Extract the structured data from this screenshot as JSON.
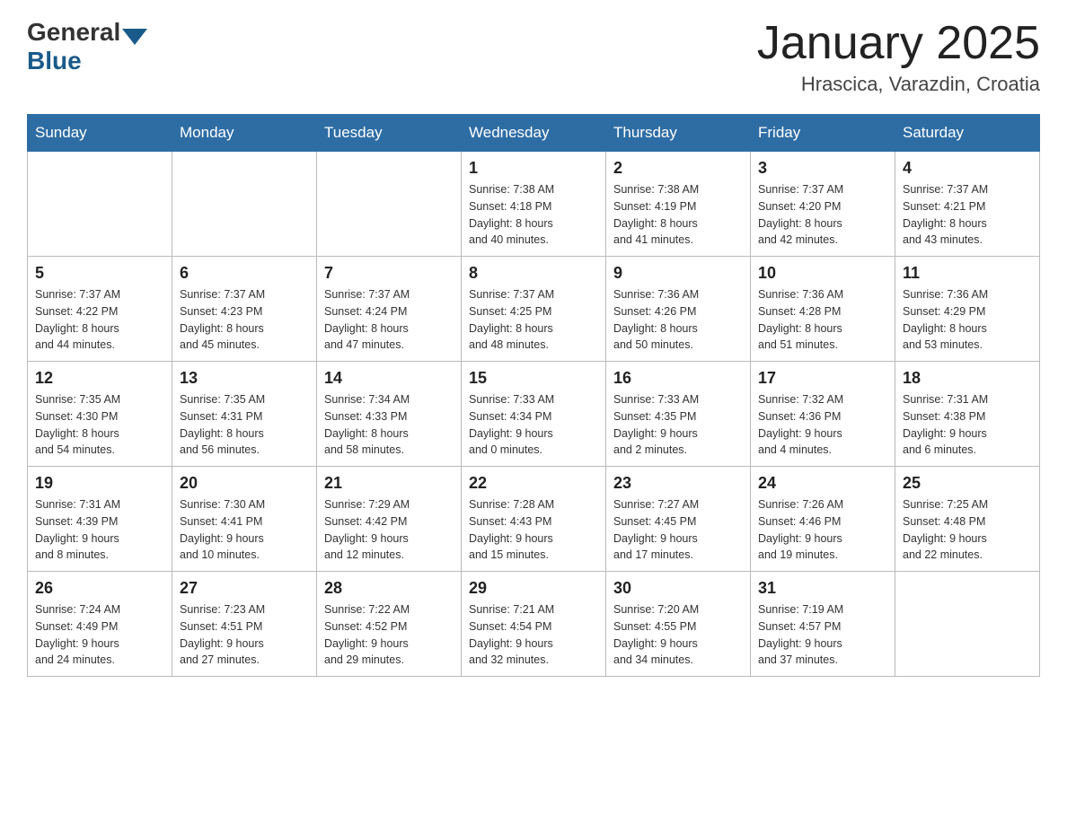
{
  "header": {
    "logo_general": "General",
    "logo_blue": "Blue",
    "title": "January 2025",
    "location": "Hrascica, Varazdin, Croatia"
  },
  "days_of_week": [
    "Sunday",
    "Monday",
    "Tuesday",
    "Wednesday",
    "Thursday",
    "Friday",
    "Saturday"
  ],
  "weeks": [
    [
      {
        "day": "",
        "info": ""
      },
      {
        "day": "",
        "info": ""
      },
      {
        "day": "",
        "info": ""
      },
      {
        "day": "1",
        "info": "Sunrise: 7:38 AM\nSunset: 4:18 PM\nDaylight: 8 hours\nand 40 minutes."
      },
      {
        "day": "2",
        "info": "Sunrise: 7:38 AM\nSunset: 4:19 PM\nDaylight: 8 hours\nand 41 minutes."
      },
      {
        "day": "3",
        "info": "Sunrise: 7:37 AM\nSunset: 4:20 PM\nDaylight: 8 hours\nand 42 minutes."
      },
      {
        "day": "4",
        "info": "Sunrise: 7:37 AM\nSunset: 4:21 PM\nDaylight: 8 hours\nand 43 minutes."
      }
    ],
    [
      {
        "day": "5",
        "info": "Sunrise: 7:37 AM\nSunset: 4:22 PM\nDaylight: 8 hours\nand 44 minutes."
      },
      {
        "day": "6",
        "info": "Sunrise: 7:37 AM\nSunset: 4:23 PM\nDaylight: 8 hours\nand 45 minutes."
      },
      {
        "day": "7",
        "info": "Sunrise: 7:37 AM\nSunset: 4:24 PM\nDaylight: 8 hours\nand 47 minutes."
      },
      {
        "day": "8",
        "info": "Sunrise: 7:37 AM\nSunset: 4:25 PM\nDaylight: 8 hours\nand 48 minutes."
      },
      {
        "day": "9",
        "info": "Sunrise: 7:36 AM\nSunset: 4:26 PM\nDaylight: 8 hours\nand 50 minutes."
      },
      {
        "day": "10",
        "info": "Sunrise: 7:36 AM\nSunset: 4:28 PM\nDaylight: 8 hours\nand 51 minutes."
      },
      {
        "day": "11",
        "info": "Sunrise: 7:36 AM\nSunset: 4:29 PM\nDaylight: 8 hours\nand 53 minutes."
      }
    ],
    [
      {
        "day": "12",
        "info": "Sunrise: 7:35 AM\nSunset: 4:30 PM\nDaylight: 8 hours\nand 54 minutes."
      },
      {
        "day": "13",
        "info": "Sunrise: 7:35 AM\nSunset: 4:31 PM\nDaylight: 8 hours\nand 56 minutes."
      },
      {
        "day": "14",
        "info": "Sunrise: 7:34 AM\nSunset: 4:33 PM\nDaylight: 8 hours\nand 58 minutes."
      },
      {
        "day": "15",
        "info": "Sunrise: 7:33 AM\nSunset: 4:34 PM\nDaylight: 9 hours\nand 0 minutes."
      },
      {
        "day": "16",
        "info": "Sunrise: 7:33 AM\nSunset: 4:35 PM\nDaylight: 9 hours\nand 2 minutes."
      },
      {
        "day": "17",
        "info": "Sunrise: 7:32 AM\nSunset: 4:36 PM\nDaylight: 9 hours\nand 4 minutes."
      },
      {
        "day": "18",
        "info": "Sunrise: 7:31 AM\nSunset: 4:38 PM\nDaylight: 9 hours\nand 6 minutes."
      }
    ],
    [
      {
        "day": "19",
        "info": "Sunrise: 7:31 AM\nSunset: 4:39 PM\nDaylight: 9 hours\nand 8 minutes."
      },
      {
        "day": "20",
        "info": "Sunrise: 7:30 AM\nSunset: 4:41 PM\nDaylight: 9 hours\nand 10 minutes."
      },
      {
        "day": "21",
        "info": "Sunrise: 7:29 AM\nSunset: 4:42 PM\nDaylight: 9 hours\nand 12 minutes."
      },
      {
        "day": "22",
        "info": "Sunrise: 7:28 AM\nSunset: 4:43 PM\nDaylight: 9 hours\nand 15 minutes."
      },
      {
        "day": "23",
        "info": "Sunrise: 7:27 AM\nSunset: 4:45 PM\nDaylight: 9 hours\nand 17 minutes."
      },
      {
        "day": "24",
        "info": "Sunrise: 7:26 AM\nSunset: 4:46 PM\nDaylight: 9 hours\nand 19 minutes."
      },
      {
        "day": "25",
        "info": "Sunrise: 7:25 AM\nSunset: 4:48 PM\nDaylight: 9 hours\nand 22 minutes."
      }
    ],
    [
      {
        "day": "26",
        "info": "Sunrise: 7:24 AM\nSunset: 4:49 PM\nDaylight: 9 hours\nand 24 minutes."
      },
      {
        "day": "27",
        "info": "Sunrise: 7:23 AM\nSunset: 4:51 PM\nDaylight: 9 hours\nand 27 minutes."
      },
      {
        "day": "28",
        "info": "Sunrise: 7:22 AM\nSunset: 4:52 PM\nDaylight: 9 hours\nand 29 minutes."
      },
      {
        "day": "29",
        "info": "Sunrise: 7:21 AM\nSunset: 4:54 PM\nDaylight: 9 hours\nand 32 minutes."
      },
      {
        "day": "30",
        "info": "Sunrise: 7:20 AM\nSunset: 4:55 PM\nDaylight: 9 hours\nand 34 minutes."
      },
      {
        "day": "31",
        "info": "Sunrise: 7:19 AM\nSunset: 4:57 PM\nDaylight: 9 hours\nand 37 minutes."
      },
      {
        "day": "",
        "info": ""
      }
    ]
  ]
}
